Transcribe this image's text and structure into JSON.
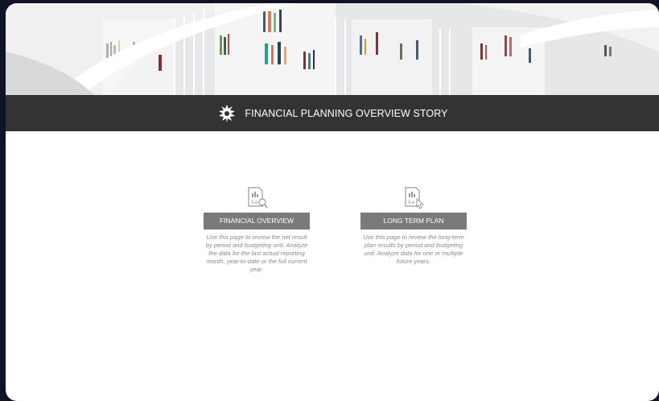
{
  "header": {
    "title": "FINANCIAL PLANNING OVERVIEW STORY",
    "logo_icon": "university-flame-logo-icon"
  },
  "cards": [
    {
      "button_label": "FINANCIAL OVERVIEW",
      "icon": "report-magnifier-icon",
      "description": "Use this page to review the net result by period and budgeting unit. Analyze the data for the last actual reporting month, year-to-date or the full current year."
    },
    {
      "button_label": "LONG TERM PLAN",
      "icon": "report-pointer-icon",
      "description": "Use this page to review the long-term plan results by period and budgeting unit. Analyze data for one or multiple future years."
    }
  ],
  "colors": {
    "page_border": "#0e1426",
    "header_bar": "#333333",
    "button": "#7a7a7a",
    "description_text": "#8a8a8a"
  }
}
